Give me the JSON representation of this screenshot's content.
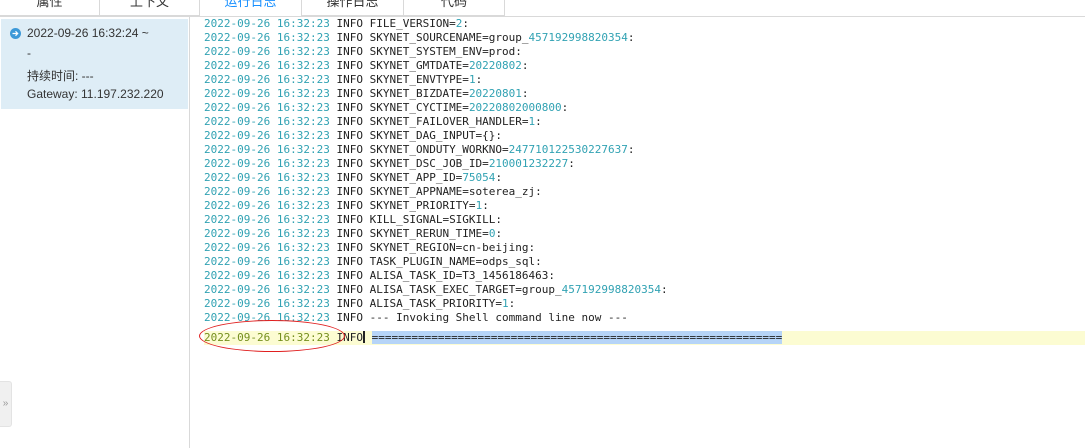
{
  "tabs": [
    {
      "label": "属性",
      "active": false
    },
    {
      "label": "上下文",
      "active": false
    },
    {
      "label": "运行日志",
      "active": true
    },
    {
      "label": "操作日志",
      "active": false
    },
    {
      "label": "代码",
      "active": false
    }
  ],
  "sidebar": {
    "run": {
      "time": "2022-09-26 16:32:24 ~",
      "end": "-",
      "duration": "持续时间: ---",
      "gateway": "Gateway: 11.197.232.220"
    },
    "collapse_label": "»"
  },
  "log": {
    "lines": [
      {
        "ts": "2022-09-26 16:32:23",
        "level": "INFO",
        "key": "FILE_VERSION=",
        "value": "2",
        "tail": ":"
      },
      {
        "ts": "2022-09-26 16:32:23",
        "level": "INFO",
        "key": "SKYNET_SOURCENAME=group_",
        "value": "457192998820354",
        "tail": ":"
      },
      {
        "ts": "2022-09-26 16:32:23",
        "level": "INFO",
        "key": "SKYNET_SYSTEM_ENV=prod:",
        "value": "",
        "tail": ""
      },
      {
        "ts": "2022-09-26 16:32:23",
        "level": "INFO",
        "key": "SKYNET_GMTDATE=",
        "value": "20220802",
        "tail": ":"
      },
      {
        "ts": "2022-09-26 16:32:23",
        "level": "INFO",
        "key": "SKYNET_ENVTYPE=",
        "value": "1",
        "tail": ":"
      },
      {
        "ts": "2022-09-26 16:32:23",
        "level": "INFO",
        "key": "SKYNET_BIZDATE=",
        "value": "20220801",
        "tail": ":"
      },
      {
        "ts": "2022-09-26 16:32:23",
        "level": "INFO",
        "key": "SKYNET_CYCTIME=",
        "value": "20220802000800",
        "tail": ":"
      },
      {
        "ts": "2022-09-26 16:32:23",
        "level": "INFO",
        "key": "SKYNET_FAILOVER_HANDLER=",
        "value": "1",
        "tail": ":"
      },
      {
        "ts": "2022-09-26 16:32:23",
        "level": "INFO",
        "key": "SKYNET_DAG_INPUT={}:",
        "value": "",
        "tail": ""
      },
      {
        "ts": "2022-09-26 16:32:23",
        "level": "INFO",
        "key": "SKYNET_ONDUTY_WORKNO=",
        "value": "247710122530227637",
        "tail": ":"
      },
      {
        "ts": "2022-09-26 16:32:23",
        "level": "INFO",
        "key": "SKYNET_DSC_JOB_ID=",
        "value": "210001232227",
        "tail": ":"
      },
      {
        "ts": "2022-09-26 16:32:23",
        "level": "INFO",
        "key": "SKYNET_APP_ID=",
        "value": "75054",
        "tail": ":"
      },
      {
        "ts": "2022-09-26 16:32:23",
        "level": "INFO",
        "key": "SKYNET_APPNAME=soterea_zj:",
        "value": "",
        "tail": ""
      },
      {
        "ts": "2022-09-26 16:32:23",
        "level": "INFO",
        "key": "SKYNET_PRIORITY=",
        "value": "1",
        "tail": ":"
      },
      {
        "ts": "2022-09-26 16:32:23",
        "level": "INFO",
        "key": "KILL_SIGNAL=SIGKILL:",
        "value": "",
        "tail": ""
      },
      {
        "ts": "2022-09-26 16:32:23",
        "level": "INFO",
        "key": "SKYNET_RERUN_TIME=",
        "value": "0",
        "tail": ":"
      },
      {
        "ts": "2022-09-26 16:32:23",
        "level": "INFO",
        "key": "SKYNET_REGION=cn-beijing:",
        "value": "",
        "tail": ""
      },
      {
        "ts": "2022-09-26 16:32:23",
        "level": "INFO",
        "key": "TASK_PLUGIN_NAME=odps_sql:",
        "value": "",
        "tail": ""
      },
      {
        "ts": "2022-09-26 16:32:23",
        "level": "INFO",
        "key": "ALISA_TASK_ID=T3_1456186463:",
        "value": "",
        "tail": ""
      },
      {
        "ts": "2022-09-26 16:32:23",
        "level": "INFO",
        "key": "ALISA_TASK_EXEC_TARGET=group_",
        "value": "457192998820354",
        "tail": ":"
      },
      {
        "ts": "2022-09-26 16:32:23",
        "level": "INFO",
        "key": "ALISA_TASK_PRIORITY=",
        "value": "1",
        "tail": ":"
      },
      {
        "ts": "2022-09-26 16:32:23",
        "level": "INFO",
        "key": "--- Invoking Shell command line now ---",
        "value": "",
        "tail": ""
      }
    ],
    "last": {
      "ts": "2022-09-26 16:32:23",
      "level": "INFO",
      "selected": "=============================================================="
    }
  },
  "colors": {
    "accent": "#1890ff",
    "timestamp": "#31a2b3",
    "last_timestamp": "#758f1e",
    "selection": "#b6d4f7",
    "current_line": "#fcfcd2",
    "annotation": "#e01f1f",
    "sidebar_selected": "#deedf6"
  }
}
